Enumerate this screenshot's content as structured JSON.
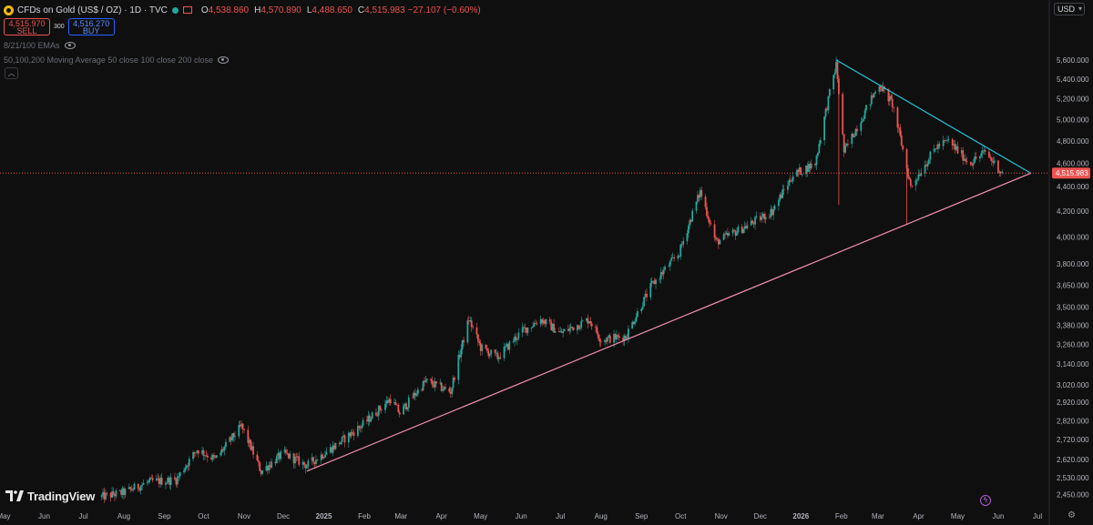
{
  "header": {
    "title": "CFDs on Gold (US$ / OZ) · 1D · TVC",
    "ohlc": [
      {
        "k": "O",
        "v": "4,538.860"
      },
      {
        "k": "H",
        "v": "4,570.890"
      },
      {
        "k": "L",
        "v": "4,488.650"
      },
      {
        "k": "C",
        "v": "4,515.983"
      }
    ],
    "change": "−27.107 (−0.60%)"
  },
  "trade": {
    "sell_price": "4,515.970",
    "sell_label": "SELL",
    "spread": "300",
    "buy_price": "4,516.270",
    "buy_label": "BUY"
  },
  "indicators": {
    "ema": "8/21/100 EMAs",
    "ma": "50,100,200 Moving Average 50 close 100 close 200 close"
  },
  "currency": "USD",
  "brand": "TradingView",
  "colors": {
    "up": "#26a69a",
    "down": "#ef5350",
    "support_line": "#f48fb1",
    "resistance_line": "#26c6da",
    "price_label": "#ef5350",
    "background": "#0f0f0f"
  },
  "chart_data": {
    "type": "candlestick",
    "y_scale": "log",
    "ylim": [
      2380,
      5820
    ],
    "y_ticks": [
      "5,600.000",
      "5,400.000",
      "5,200.000",
      "5,000.000",
      "4,800.000",
      "4,600.000",
      "4,400.000",
      "4,200.000",
      "4,000.000",
      "3,800.000",
      "3,650.000",
      "3,500.000",
      "3,380.000",
      "3,260.000",
      "3,140.000",
      "3,020.000",
      "2,920.000",
      "2,820.000",
      "2,720.000",
      "2,620.000",
      "2,530.000",
      "2,450.000"
    ],
    "x_labels": [
      "May",
      "Jun",
      "Jul",
      "Aug",
      "Sep",
      "Oct",
      "Nov",
      "Dec",
      "2025",
      "Feb",
      "Mar",
      "Apr",
      "May",
      "Jun",
      "Jul",
      "Aug",
      "Sep",
      "Oct",
      "Nov",
      "Dec",
      "2026",
      "Feb",
      "Mar",
      "Apr",
      "May",
      "Jun",
      "Jul"
    ],
    "x_months": [
      "2024-05",
      "2024-06",
      "2024-07",
      "2024-08",
      "2024-09",
      "2024-10",
      "2024-11",
      "2024-12",
      "2025-01",
      "2025-02",
      "2025-03",
      "2025-04",
      "2025-05",
      "2025-06",
      "2025-07",
      "2025-08",
      "2025-09",
      "2025-10",
      "2025-11",
      "2025-12",
      "2026-01",
      "2026-02",
      "2026-03",
      "2026-04",
      "2026-05",
      "2026-06",
      "2026-07"
    ],
    "price_path": [
      [
        "2024-07-15",
        2440
      ],
      [
        "2024-08-01",
        2460
      ],
      [
        "2024-08-20",
        2510
      ],
      [
        "2024-09-10",
        2520
      ],
      [
        "2024-09-26",
        2670
      ],
      [
        "2024-10-10",
        2620
      ],
      [
        "2024-10-30",
        2790
      ],
      [
        "2024-11-14",
        2560
      ],
      [
        "2024-12-01",
        2650
      ],
      [
        "2024-12-19",
        2590
      ],
      [
        "2025-01-10",
        2690
      ],
      [
        "2025-01-31",
        2800
      ],
      [
        "2025-02-21",
        2940
      ],
      [
        "2025-02-28",
        2860
      ],
      [
        "2025-03-20",
        3040
      ],
      [
        "2025-04-08",
        2980
      ],
      [
        "2025-04-22",
        3420
      ],
      [
        "2025-05-01",
        3240
      ],
      [
        "2025-05-14",
        3180
      ],
      [
        "2025-06-01",
        3340
      ],
      [
        "2025-06-16",
        3420
      ],
      [
        "2025-07-01",
        3330
      ],
      [
        "2025-07-23",
        3420
      ],
      [
        "2025-08-01",
        3290
      ],
      [
        "2025-08-20",
        3310
      ],
      [
        "2025-09-09",
        3650
      ],
      [
        "2025-09-30",
        3880
      ],
      [
        "2025-10-16",
        4360
      ],
      [
        "2025-10-28",
        3960
      ],
      [
        "2025-11-20",
        4080
      ],
      [
        "2025-12-10",
        4200
      ],
      [
        "2025-12-26",
        4500
      ],
      [
        "2026-01-12",
        4600
      ],
      [
        "2026-01-28",
        5550
      ],
      [
        "2026-02-03",
        4700
      ],
      [
        "2026-02-16",
        5000
      ],
      [
        "2026-03-02",
        5350
      ],
      [
        "2026-03-12",
        5150
      ],
      [
        "2026-03-26",
        4400
      ],
      [
        "2026-04-15",
        4750
      ],
      [
        "2026-04-24",
        4800
      ],
      [
        "2026-05-10",
        4600
      ],
      [
        "2026-05-22",
        4700
      ],
      [
        "2026-06-04",
        4516
      ]
    ],
    "last_price": "4,515.983",
    "trendlines": [
      {
        "role": "support",
        "from": [
          "2024-12-19",
          2562
        ],
        "to": [
          "2026-06-26",
          4515
        ]
      },
      {
        "role": "resistance",
        "from": [
          "2026-01-28",
          5600
        ],
        "to": [
          "2026-06-26",
          4515
        ]
      }
    ],
    "grid": false,
    "legend": "none"
  }
}
